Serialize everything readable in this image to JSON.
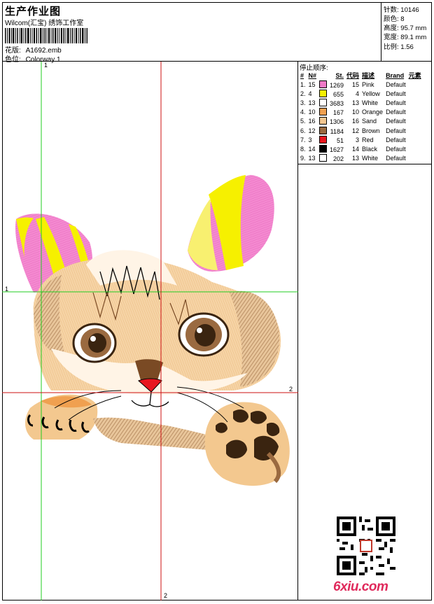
{
  "header": {
    "title": "生产作业图",
    "company": "Wilcom(汇宝) 绣饰工作室",
    "design_label": "花版:",
    "design_file": "A1692.emb",
    "colorway_label": "色位:",
    "colorway": "Colorway 1"
  },
  "stats": [
    {
      "label": "针数:",
      "value": "10146"
    },
    {
      "label": "颜色:",
      "value": "8"
    },
    {
      "label": "高度:",
      "value": "95.7 mm"
    },
    {
      "label": "宽度:",
      "value": "89.1 mm"
    },
    {
      "label": "比例:",
      "value": "1.56"
    }
  ],
  "stop_sequence": {
    "title": "停止顺序:",
    "columns": [
      "#",
      "N#",
      "St.",
      "代码",
      "描述",
      "Brand",
      "元素"
    ],
    "rows": [
      {
        "idx": "1.",
        "needle": "15",
        "color": "#f07ac8",
        "stitches": "1269",
        "code": "15",
        "desc": "Pink",
        "brand": "Default"
      },
      {
        "idx": "2.",
        "needle": "4",
        "color": "#f5f000",
        "stitches": "655",
        "code": "4",
        "desc": "Yellow",
        "brand": "Default"
      },
      {
        "idx": "3.",
        "needle": "13",
        "color": "#ffffff",
        "stitches": "3683",
        "code": "13",
        "desc": "White",
        "brand": "Default"
      },
      {
        "idx": "4.",
        "needle": "10",
        "color": "#f0a050",
        "stitches": "167",
        "code": "10",
        "desc": "Orange",
        "brand": "Default"
      },
      {
        "idx": "5.",
        "needle": "16",
        "color": "#f2c690",
        "stitches": "1306",
        "code": "16",
        "desc": "Sand",
        "brand": "Default"
      },
      {
        "idx": "6.",
        "needle": "12",
        "color": "#9a6a40",
        "stitches": "1184",
        "code": "12",
        "desc": "Brown",
        "brand": "Default"
      },
      {
        "idx": "7.",
        "needle": "3",
        "color": "#e8161e",
        "stitches": "51",
        "code": "3",
        "desc": "Red",
        "brand": "Default"
      },
      {
        "idx": "8.",
        "needle": "14",
        "color": "#000000",
        "stitches": "1627",
        "code": "14",
        "desc": "Black",
        "brand": "Default"
      },
      {
        "idx": "9.",
        "needle": "13",
        "color": "#ffffff",
        "stitches": "202",
        "code": "13",
        "desc": "White",
        "brand": "Default"
      }
    ]
  },
  "guides": {
    "green_label_top": "1",
    "green_label_left": "1",
    "red_label_right": "2",
    "red_label_bottom": "2"
  },
  "colors": {
    "green_guide": "#22cc22",
    "red_guide": "#cc1111",
    "logo": "#e02a5c"
  },
  "watermark": {
    "site": "6xiu.com"
  }
}
